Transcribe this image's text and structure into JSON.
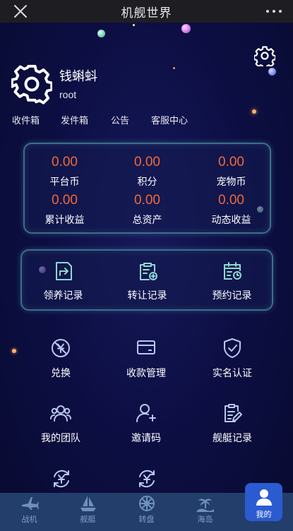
{
  "app": {
    "title": "机舰世界"
  },
  "profile": {
    "name": "钱蝌蚪",
    "id": "root"
  },
  "links": [
    "收件箱",
    "发件箱",
    "公告",
    "客服中心"
  ],
  "stats": [
    {
      "value": "0.00",
      "label": "平台币"
    },
    {
      "value": "0.00",
      "label": "积分"
    },
    {
      "value": "0.00",
      "label": "宠物币"
    },
    {
      "value": "0.00",
      "label": "累计收益"
    },
    {
      "value": "0.00",
      "label": "总资产"
    },
    {
      "value": "0.00",
      "label": "动态收益"
    }
  ],
  "records": [
    {
      "label": "领养记录",
      "icon": "adopt-record-icon"
    },
    {
      "label": "转让记录",
      "icon": "transfer-record-icon"
    },
    {
      "label": "预约记录",
      "icon": "reserve-record-icon"
    }
  ],
  "grid": [
    {
      "label": "兑换",
      "icon": "exchange-icon"
    },
    {
      "label": "收款管理",
      "icon": "payment-card-icon"
    },
    {
      "label": "实名认证",
      "icon": "shield-check-icon"
    },
    {
      "label": "我的团队",
      "icon": "team-icon"
    },
    {
      "label": "邀请码",
      "icon": "invite-user-icon"
    },
    {
      "label": "舰艇记录",
      "icon": "ship-record-icon"
    }
  ],
  "tabs": [
    {
      "label": "战机",
      "icon": "fighter-jet-icon"
    },
    {
      "label": "舰艇",
      "icon": "ship-icon"
    },
    {
      "label": "转盘",
      "icon": "wheel-icon"
    },
    {
      "label": "海岛",
      "icon": "island-icon"
    },
    {
      "label": "我的",
      "icon": "user-icon",
      "active": true
    }
  ],
  "colors": {
    "accent": "#f0693a",
    "icon_teal": "#8fd8cf",
    "tab_active": "#2b5bd0",
    "background": "#0b0e3a"
  }
}
